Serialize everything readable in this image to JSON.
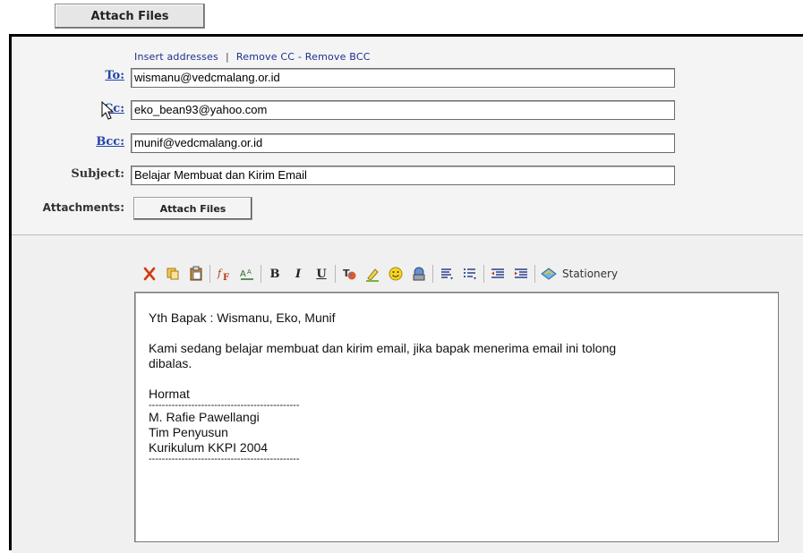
{
  "top_button": {
    "label": "Attach Files"
  },
  "address_links": {
    "insert": "Insert addresses",
    "separator": "|",
    "remove_cc": "Remove CC",
    "dash": "-",
    "remove_bcc": "Remove BCC"
  },
  "fields": {
    "to": {
      "label": "To:",
      "value": "wismanu@vedcmalang.or.id"
    },
    "cc": {
      "label": "Cc:",
      "value": "eko_bean93@yahoo.com"
    },
    "bcc": {
      "label": "Bcc:",
      "value": "munif@vedcmalang.or.id"
    },
    "subject": {
      "label": "Subject:",
      "value": "Belajar Membuat dan Kirim Email"
    },
    "attachments": {
      "label": "Attachments:",
      "button": "Attach Files"
    }
  },
  "toolbar": {
    "icons": [
      "cut-icon",
      "copy-icon",
      "paste-icon",
      "font-icon",
      "font-size-icon",
      "bold-icon",
      "italic-icon",
      "underline-icon",
      "text-color-icon",
      "highlight-icon",
      "emoticon-icon",
      "insert-link-icon",
      "align-icon",
      "list-icon",
      "outdent-icon",
      "indent-icon",
      "stationery-icon"
    ],
    "bold": "B",
    "italic": "I",
    "underline": "U",
    "stationery": "Stationery"
  },
  "body": {
    "greeting": "Yth Bapak : Wismanu, Eko, Munif",
    "line1": "Kami sedang belajar membuat dan kirim email, jika bapak menerima email ini tolong",
    "line2": "dibalas.",
    "closing": "Hormat",
    "dashes": "----------------------------------------------",
    "sig_name": "M. Rafie Pawellangi",
    "sig_team": "Tim Penyusun",
    "sig_curr": "Kurikulum KKPI 2004"
  }
}
